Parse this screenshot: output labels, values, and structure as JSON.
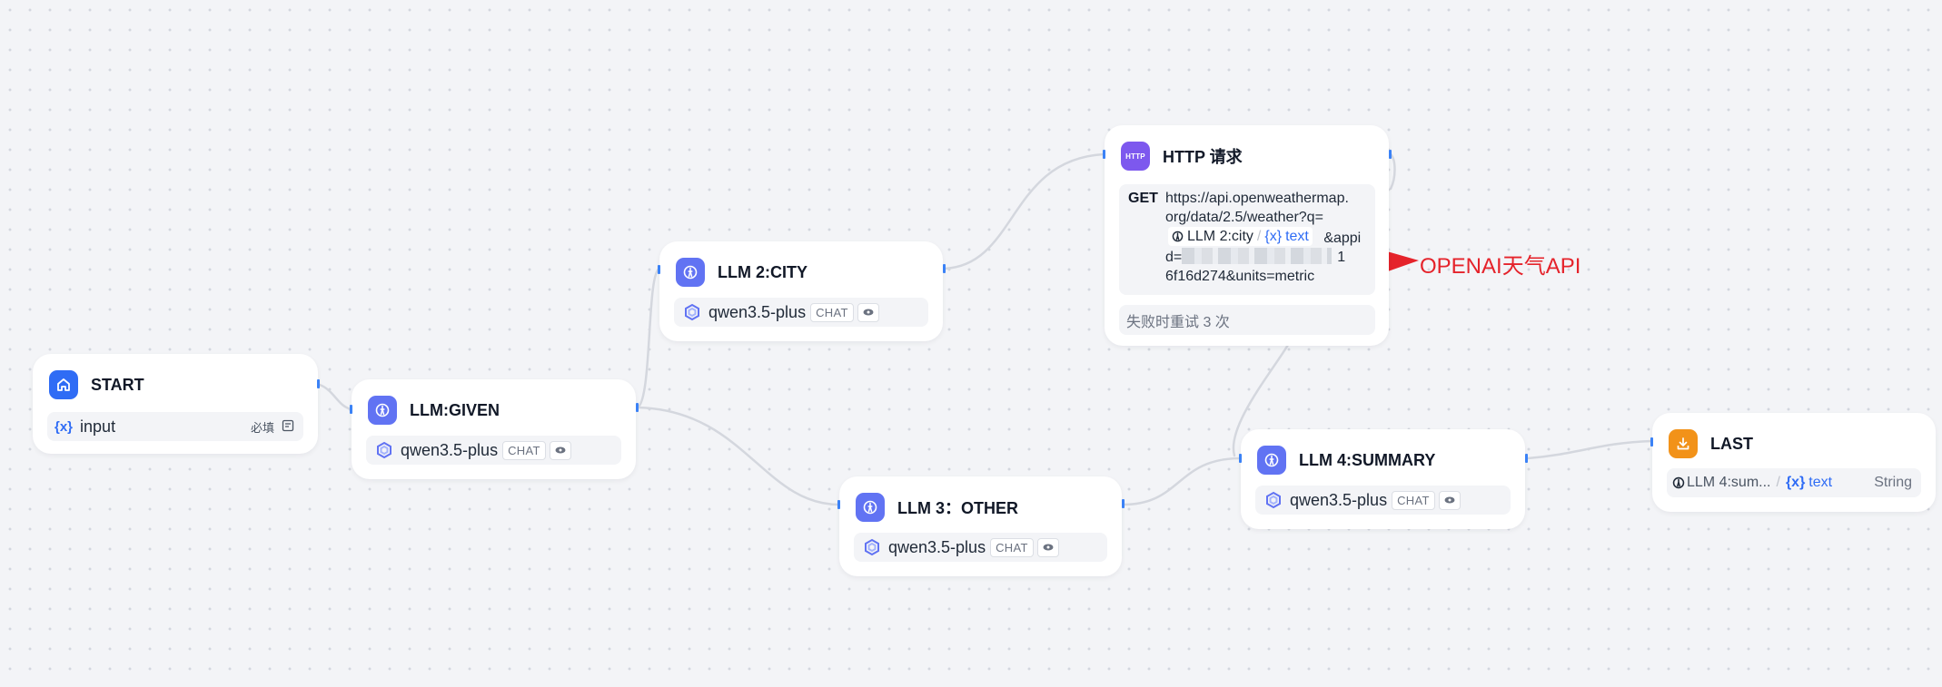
{
  "nodes": {
    "start": {
      "title": "START",
      "var_icon": "{x}",
      "field": "input",
      "required": "必填"
    },
    "llm_given": {
      "title": "LLM:GIVEN",
      "model": "qwen3.5-plus",
      "mode": "CHAT"
    },
    "llm_city": {
      "title": "LLM 2:CITY",
      "model": "qwen3.5-plus",
      "mode": "CHAT"
    },
    "http": {
      "title": "HTTP 请求",
      "icon_label": "HTTP",
      "method": "GET",
      "url_line1": "https://api.openweathermap.",
      "url_line2": "org/data/2.5/weather?q=",
      "chip_source": "LLM 2:city",
      "chip_var_icon": "{x}",
      "chip_var": "text",
      "url_line3_tail": "&appi",
      "url_line4_start": "d=",
      "url_line4_end": "1",
      "url_line5": "6f16d274&units=metric",
      "retry": "失败时重试 3 次"
    },
    "llm_other": {
      "title": "LLM 3：OTHER",
      "model": "qwen3.5-plus",
      "mode": "CHAT"
    },
    "llm_summary": {
      "title": "LLM 4:SUMMARY",
      "model": "qwen3.5-plus",
      "mode": "CHAT"
    },
    "last": {
      "title": "LAST",
      "source": "LLM 4:sum...",
      "var_icon": "{x}",
      "var": "text",
      "type": "String"
    }
  },
  "annotation": {
    "text": "OPENAI天气API",
    "color": "#e5232b"
  },
  "icons": {
    "start": "home-icon",
    "llm": "llm-node-icon",
    "http": "http-icon",
    "last": "end-node-icon",
    "model": "qwen-logo-icon",
    "view": "eye-icon",
    "form": "form-icon"
  },
  "colors": {
    "canvas": "#f3f4f7",
    "accent": "#2f6cf5",
    "llm_icon": "#6173f3",
    "http_icon": "#7d58ee",
    "end_icon": "#f29219",
    "edge": "#d1d5db",
    "port": "#3b82f6"
  }
}
